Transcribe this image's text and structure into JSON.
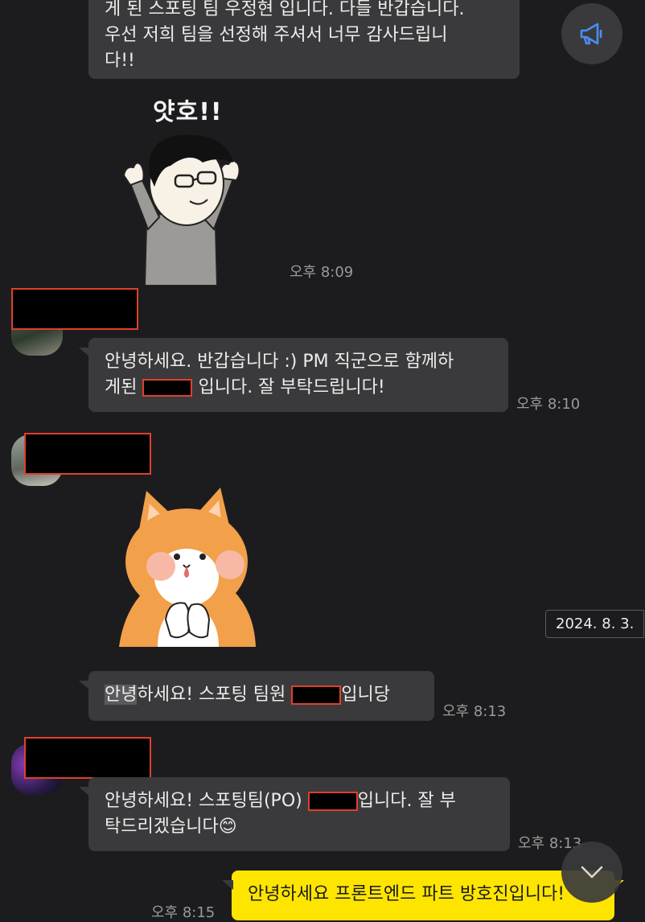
{
  "messages": {
    "m1_line1": "게 된 스포팅 팀 우정현 입니다. 다들 반갑습니다.",
    "m1_line2": "우선 저희 팀을 선정해 주셔서 너무 감사드립니",
    "m1_line3": "다!!",
    "sticker1_caption": "얏호!!",
    "time1": "오후 8:09",
    "m2_line1": "안녕하세요. 반갑습니다 :) PM 직군으로 함께하",
    "m2_line2_pre": "게된 ",
    "m2_line2_post": " 입니다. 잘 부탁드립니다!",
    "time2": "오후 8:10",
    "m3_hl": "안녕",
    "m3_pre": "하세요! 스포팅 팀원 ",
    "m3_post": "입니당",
    "time3": "오후 8:13",
    "m4_line1_pre": "안녕하세요! 스포팅팀(PO) ",
    "m4_line1_post": "입니다. 잘 부",
    "m4_line2": "탁드리겠습니다",
    "m4_emoji": "😊",
    "time4": "오후 8:13",
    "m5": "안녕하세요 프론트엔드 파트 방호진입니다!",
    "time5": "오후 8:15"
  },
  "date_badge": "2024. 8. 3.",
  "icons": {
    "announce": "megaphone-icon",
    "scroll_down": "chevron-down-icon"
  },
  "colors": {
    "background": "#1c1c1e",
    "bubble": "#3a3a3c",
    "my_bubble": "#fee500",
    "redaction_border": "#e0402a"
  }
}
